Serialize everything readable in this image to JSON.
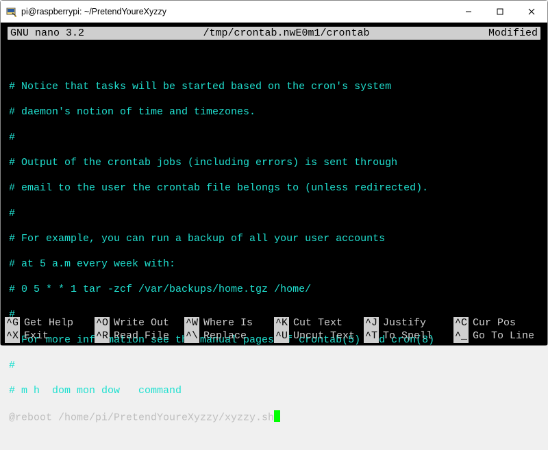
{
  "window": {
    "title": "pi@raspberrypi: ~/PretendYoureXyzzy"
  },
  "nano": {
    "app": "GNU nano 3.2",
    "filepath": "/tmp/crontab.nwE0m1/crontab",
    "status": "Modified"
  },
  "lines": {
    "l0": "# Notice that tasks will be started based on the cron's system",
    "l1": "# daemon's notion of time and timezones.",
    "l2": "#",
    "l3": "# Output of the crontab jobs (including errors) is sent through",
    "l4": "# email to the user the crontab file belongs to (unless redirected).",
    "l5": "#",
    "l6": "# For example, you can run a backup of all your user accounts",
    "l7": "# at 5 a.m every week with:",
    "l8": "# 0 5 * * 1 tar -zcf /var/backups/home.tgz /home/",
    "l9": "#",
    "l10": "# For more information see the manual pages of crontab(5) and cron(8)",
    "l11": "#",
    "l12": "# m h  dom mon dow   command",
    "l13": "@reboot /home/pi/PretendYoureXyzzy/xyzzy.sh"
  },
  "help": {
    "row1": {
      "c1": {
        "k": "^G",
        "l": "Get Help"
      },
      "c2": {
        "k": "^O",
        "l": "Write Out"
      },
      "c3": {
        "k": "^W",
        "l": "Where Is"
      },
      "c4": {
        "k": "^K",
        "l": "Cut Text"
      },
      "c5": {
        "k": "^J",
        "l": "Justify"
      },
      "c6": {
        "k": "^C",
        "l": "Cur Pos"
      }
    },
    "row2": {
      "c1": {
        "k": "^X",
        "l": "Exit"
      },
      "c2": {
        "k": "^R",
        "l": "Read File"
      },
      "c3": {
        "k": "^\\",
        "l": "Replace"
      },
      "c4": {
        "k": "^U",
        "l": "Uncut Text"
      },
      "c5": {
        "k": "^T",
        "l": "To Spell"
      },
      "c6": {
        "k": "^_",
        "l": "Go To Line"
      }
    }
  }
}
